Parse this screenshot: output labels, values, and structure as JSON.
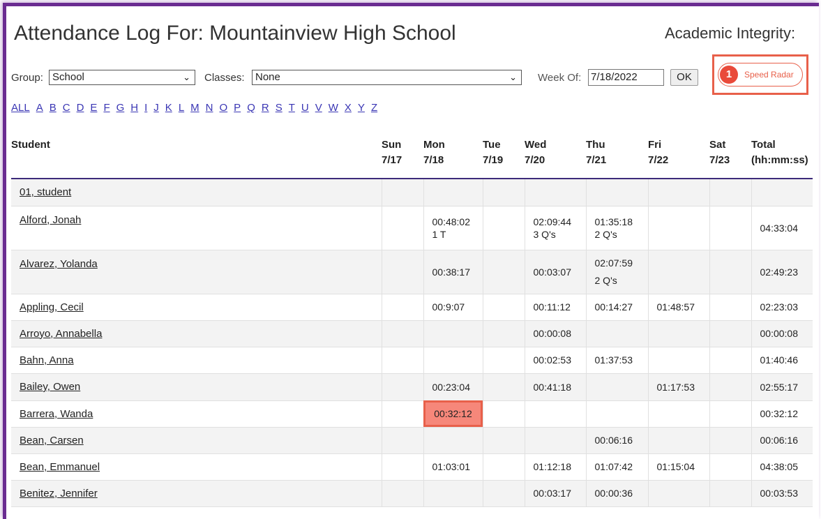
{
  "header": {
    "title": "Attendance Log For: Mountainview High School",
    "academic_integrity_label": "Academic Integrity:",
    "speed_radar": {
      "badge_count": "1",
      "label": "Speed Radar"
    }
  },
  "controls": {
    "group_label": "Group:",
    "group_value": "School",
    "classes_label": "Classes:",
    "classes_value": "None",
    "week_label": "Week Of:",
    "week_value": "7/18/2022",
    "ok_label": "OK"
  },
  "alphabet": [
    "ALL",
    "A",
    "B",
    "C",
    "D",
    "E",
    "F",
    "G",
    "H",
    "I",
    "J",
    "K",
    "L",
    "M",
    "N",
    "O",
    "P",
    "Q",
    "R",
    "S",
    "T",
    "U",
    "V",
    "W",
    "X",
    "Y",
    "Z"
  ],
  "table": {
    "columns": [
      {
        "day": "Student",
        "date": ""
      },
      {
        "day": "Sun",
        "date": "7/17"
      },
      {
        "day": "Mon",
        "date": "7/18"
      },
      {
        "day": "Tue",
        "date": "7/19"
      },
      {
        "day": "Wed",
        "date": "7/20"
      },
      {
        "day": "Thu",
        "date": "7/21"
      },
      {
        "day": "Fri",
        "date": "7/22"
      },
      {
        "day": "Sat",
        "date": "7/23"
      },
      {
        "day": "Total",
        "date": "(hh:mm:ss)"
      }
    ],
    "rows": [
      {
        "name": "01, student",
        "cells": [
          "",
          "",
          "",
          "",
          "",
          "",
          "",
          ""
        ]
      },
      {
        "name": "Alford, Jonah",
        "cells": [
          "",
          "00:48:02\n1 T",
          "",
          "02:09:44\n3 Q's",
          "01:35:18\n2 Q's",
          "",
          "",
          "04:33:04"
        ]
      },
      {
        "name": "Alvarez, Yolanda",
        "cells": [
          "",
          "00:38:17",
          "",
          "00:03:07",
          "02:07:59\n2 Q's",
          "",
          "",
          "02:49:23"
        ]
      },
      {
        "name": "Appling, Cecil",
        "cells": [
          "",
          "00:9:07",
          "",
          "00:11:12",
          "00:14:27",
          "01:48:57",
          "",
          "02:23:03"
        ]
      },
      {
        "name": "Arroyo, Annabella",
        "cells": [
          "",
          "",
          "",
          "00:00:08",
          "",
          "",
          "",
          "00:00:08"
        ]
      },
      {
        "name": "Bahn, Anna",
        "cells": [
          "",
          "",
          "",
          "00:02:53",
          "01:37:53",
          "",
          "",
          "01:40:46"
        ]
      },
      {
        "name": "Bailey, Owen",
        "cells": [
          "",
          "00:23:04",
          "",
          "00:41:18",
          "",
          "01:17:53",
          "",
          "02:55:17"
        ]
      },
      {
        "name": "Barrera, Wanda",
        "cells": [
          "",
          "00:32:12",
          "",
          "",
          "",
          "",
          "",
          "00:32:12"
        ]
      },
      {
        "name": "Bean, Carsen",
        "cells": [
          "",
          "",
          "",
          "",
          "00:06:16",
          "",
          "",
          "00:06:16"
        ]
      },
      {
        "name": "Bean, Emmanuel",
        "cells": [
          "",
          "01:03:01",
          "",
          "01:12:18",
          "01:07:42",
          "01:15:04",
          "",
          "04:38:05"
        ]
      },
      {
        "name": "Benitez, Jennifer",
        "cells": [
          "",
          "",
          "",
          "00:03:17",
          "00:00:36",
          "",
          "",
          "00:03:53"
        ]
      }
    ]
  },
  "colors": {
    "accent_purple": "#6a2c91",
    "highlight_red": "#e8604a",
    "link_blue": "#3a36b4"
  },
  "icons": {
    "dropdown": "chevron-down-icon"
  }
}
